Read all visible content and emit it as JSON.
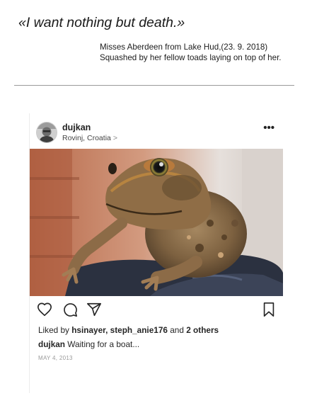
{
  "header": {
    "quote": "«I want nothing but death.»",
    "caption_line1": "Misses Aberdeen from Lake Hud,(23. 9. 2018)",
    "caption_line2": "Squashed by her fellow toads laying on top of her."
  },
  "post": {
    "username": "dujkan",
    "location": "Rovinj, Croatia",
    "location_chevron": ">",
    "more_label": "•••",
    "image_subject": "cane toad perched on a gloved hand",
    "likes": {
      "prefix": "Liked by ",
      "users": "hsinayer, steph_anie176",
      "joiner": " and ",
      "others": "2 others"
    },
    "caption": {
      "username": "dujkan",
      "text": " Waiting for a boat..."
    },
    "date": "MAY 4, 2013",
    "icons": [
      "heart-icon",
      "comment-icon",
      "share-icon",
      "bookmark-icon"
    ]
  },
  "colors": {
    "text": "#262626",
    "muted": "#9a9a9a",
    "rule": "#9a9a9a",
    "toad_body": "#8a6a45",
    "glove": "#2b3140",
    "background_wall": "#c7785a"
  }
}
